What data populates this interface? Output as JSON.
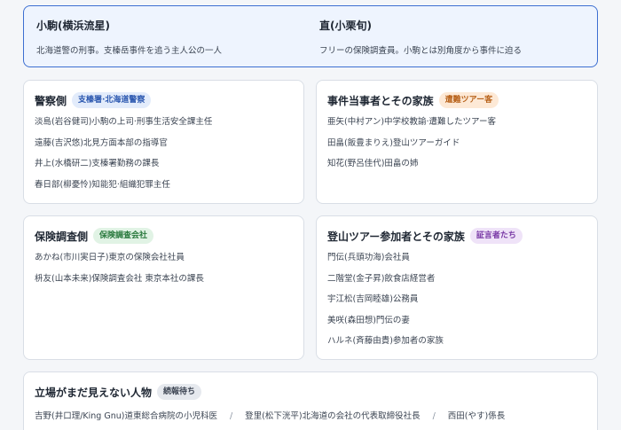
{
  "leads": [
    {
      "name": "小駒(横浜流星)",
      "desc": "北海道警の刑事。支榛岳事件を追う主人公の一人"
    },
    {
      "name": "直(小栗旬)",
      "desc": "フリーの保険調査員。小駒とは別角度から事件に迫る"
    }
  ],
  "groups": {
    "police": {
      "title": "警察側",
      "badge": "支榛署·北海道警察",
      "items": [
        "淡島(岩谷健司)小駒の上司·刑事生活安全課主任",
        "遠藤(吉沢悠)北見方面本部の指導官",
        "井上(水橋研二)支榛署勤務の課長",
        "春日部(柳憂怜)知能犯·組織犯罪主任"
      ]
    },
    "family": {
      "title": "事件当事者とその家族",
      "badge": "遭難ツアー客",
      "items": [
        "亜矢(中村アン)中学校教諭·遭難したツアー客",
        "田畠(飯豊まりえ)登山ツアーガイド",
        "知花(野呂佳代)田畠の姉"
      ]
    },
    "insurance": {
      "title": "保険調査側",
      "badge": "保険調査会社",
      "items": [
        "あかね(市川実日子)東京の保険会社社員",
        "枡友(山本未来)保険調査会社 東京本社の課長"
      ]
    },
    "tour": {
      "title": "登山ツアー参加者とその家族",
      "badge": "証言者たち",
      "items": [
        "門伝(兵頭功海)会社員",
        "二階堂(金子昇)飲食店経営者",
        "宇江松(吉岡睦雄)公務員",
        "美咲(森田想)門伝の妻",
        "ハルネ(斉藤由貴)参加者の家族"
      ]
    },
    "unknown": {
      "title": "立場がまだ見えない人物",
      "badge": "続報待ち",
      "items": [
        "吉野(井口理/King Gnu)道東総合病院の小児科医",
        "登里(松下洸平)北海道の会社の代表取締役社長",
        "西田(やす)係長"
      ],
      "separator": "/"
    }
  }
}
